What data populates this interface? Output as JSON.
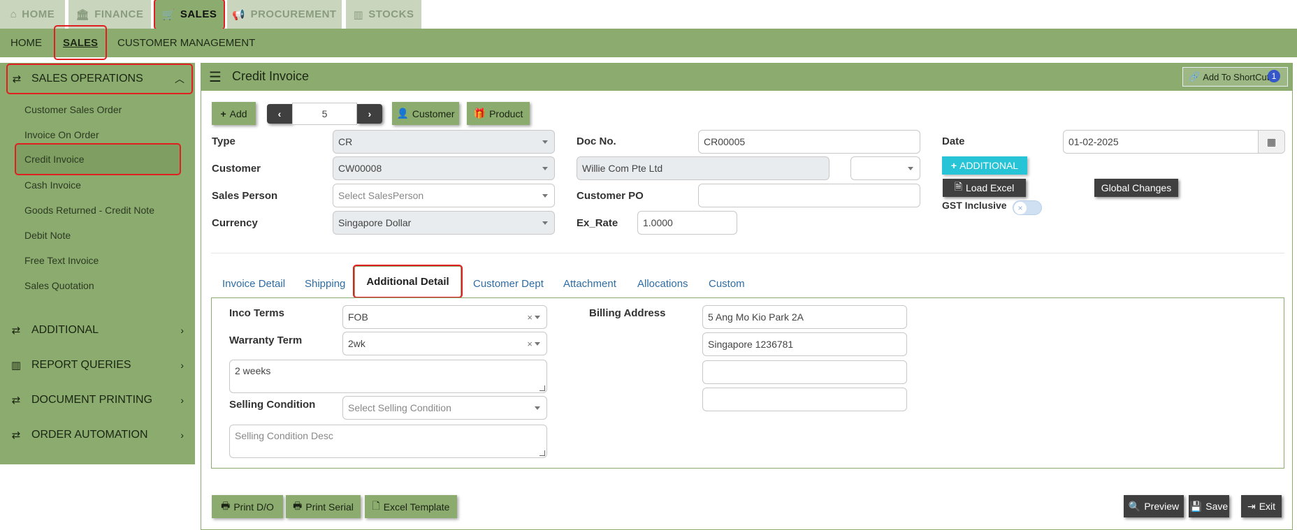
{
  "top_tabs": [
    {
      "label": "HOME",
      "icon": "home-icon"
    },
    {
      "label": "FINANCE",
      "icon": "bank-icon"
    },
    {
      "label": "SALES",
      "icon": "cart-icon"
    },
    {
      "label": "PROCUREMENT",
      "icon": "megaphone-icon"
    },
    {
      "label": "STOCKS",
      "icon": "bar-chart-icon"
    }
  ],
  "sub_nav": [
    "HOME",
    "SALES",
    "CUSTOMER MANAGEMENT"
  ],
  "sidebar": {
    "sales_operations": "SALES OPERATIONS",
    "items": [
      "Customer Sales Order",
      "Invoice On Order",
      "Credit Invoice",
      "Cash Invoice",
      "Goods Returned - Credit Note",
      "Debit Note",
      "Free Text Invoice",
      "Sales Quotation"
    ],
    "groups": [
      "ADDITIONAL",
      "REPORT QUERIES",
      "DOCUMENT PRINTING",
      "ORDER AUTOMATION"
    ]
  },
  "header": {
    "title": "Credit Invoice",
    "shortcut_label": "Add To ShortCut",
    "shortcut_badge": "1"
  },
  "toolbar": {
    "add": "Add",
    "record": "5",
    "customer": "Customer",
    "product": "Product"
  },
  "form": {
    "type_label": "Type",
    "type_value": "CR",
    "customer_label": "Customer",
    "customer_value": "CW00008",
    "sales_person_label": "Sales Person",
    "sales_person_placeholder": "Select SalesPerson",
    "currency_label": "Currency",
    "currency_value": "Singapore Dollar",
    "doc_no_label": "Doc No.",
    "doc_no_value": "CR00005",
    "customer_name_value": "Willie Com Pte Ltd",
    "customer_po_label": "Customer PO",
    "customer_po_value": "",
    "ex_rate_label": "Ex_Rate",
    "ex_rate_value": "1.0000",
    "date_label": "Date",
    "date_value": "01-02-2025",
    "additional_button": "ADDITIONAL",
    "load_excel_button": "Load Excel",
    "global_changes_button": "Global Changes",
    "gst_inclusive_label": "GST Inclusive"
  },
  "tabs": [
    "Invoice Detail",
    "Shipping",
    "Additional Detail",
    "Customer Dept",
    "Attachment",
    "Allocations",
    "Custom"
  ],
  "additional_detail": {
    "inco_terms_label": "Inco Terms",
    "inco_terms_value": "FOB",
    "warranty_term_label": "Warranty Term",
    "warranty_term_value": "2wk",
    "warranty_desc": "2 weeks",
    "selling_condition_label": "Selling Condition",
    "selling_condition_placeholder": "Select Selling Condition",
    "selling_condition_desc_placeholder": "Selling Condition Desc",
    "billing_address_label": "Billing Address",
    "billing_address_lines": [
      "5 Ang Mo Kio Park 2A",
      "Singapore 1236781",
      "",
      ""
    ]
  },
  "footer": {
    "print_do": "Print D/O",
    "print_serial": "Print Serial",
    "excel_template": "Excel Template",
    "preview": "Preview",
    "save": "Save",
    "exit": "Exit"
  },
  "colors": {
    "accent_green": "#8cab6e",
    "light_green": "#c9d6bd",
    "highlight_red": "#e02020",
    "link_blue": "#2e6da4",
    "teal": "#27c3d6"
  }
}
